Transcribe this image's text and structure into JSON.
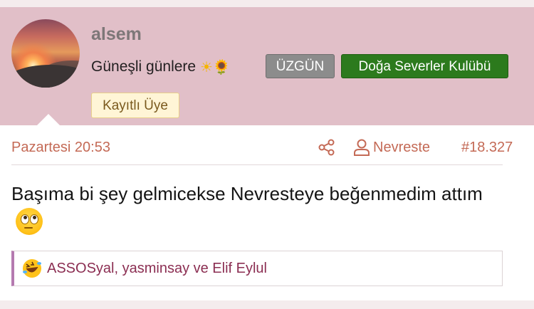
{
  "user": {
    "username": "alsem",
    "tagline": "Güneşli günlere",
    "tagline_emojis": [
      "sun-emoji",
      "sunflower-emoji"
    ],
    "badges": [
      "ÜZGÜN",
      "Doğa Severler Kulübü"
    ],
    "role": "Kayıtlı Üye"
  },
  "post": {
    "date": "Pazartesi 20:53",
    "author": "Nevreste",
    "number": "#18.327",
    "body": "Başıma bi şey gelmicekse Nevresteye beğenmedim attım",
    "body_emoji": "face-with-rolling-eyes"
  },
  "reactions": {
    "emoji": "rolling-on-floor-laughing",
    "text": "ASSOSyal, yasminsay ve Elif Eylul"
  },
  "colors": {
    "header_bg": "#e1bfc8",
    "meta_text": "#c46a56",
    "reaction_text": "#8b2e52",
    "badge_green": "#2c7a1d",
    "badge_gray": "#8c8c8c"
  }
}
